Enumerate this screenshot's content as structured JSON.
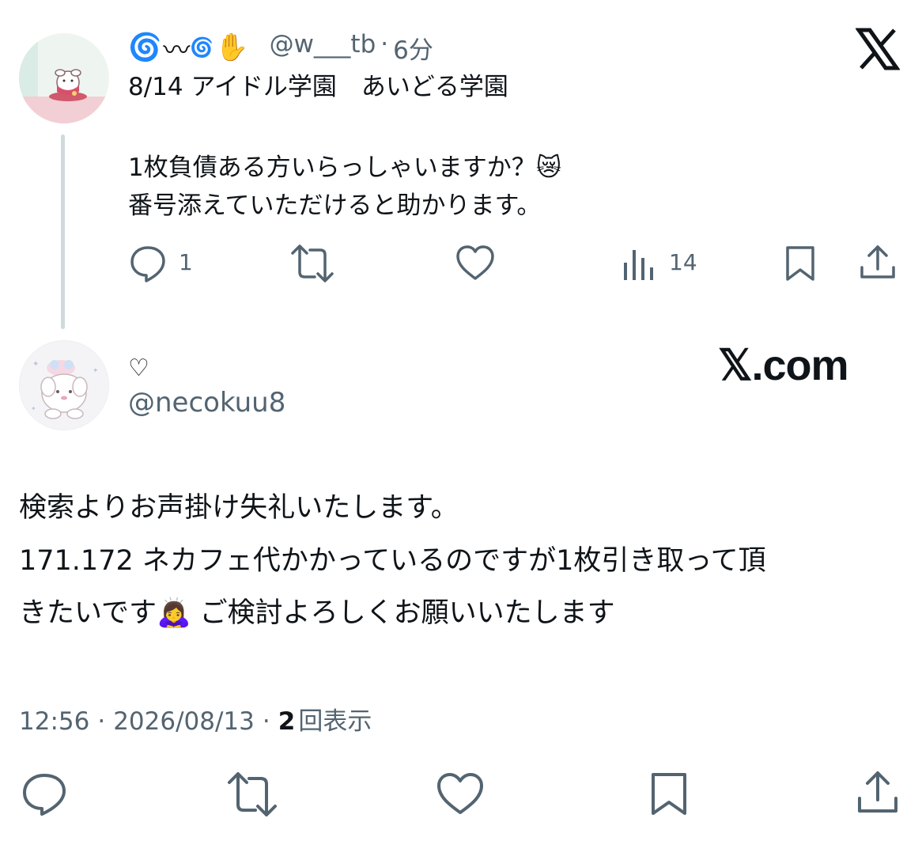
{
  "parent_tweet": {
    "author_name_glyphs": [
      "🌀",
      "〰",
      "🌀",
      "✋"
    ],
    "handle": "@w___tb",
    "separator": "·",
    "time_ago": "6分",
    "lines": [
      "8/14 アイドル学園　あいどる学園",
      "",
      "1枚負債ある方いらっしゃいますか？😿",
      "番号添えていただけると助かります。"
    ],
    "reply_count": "1",
    "retweet_count": "",
    "like_count": "",
    "view_count": "14"
  },
  "main_tweet": {
    "author_name": "♡",
    "handle": "@necokuu8",
    "lines": [
      "検索よりお声掛け失礼いたします。",
      "171.172 ネカフェ代かかっているのですが1枚引き取って頂",
      "きたいです🙇‍♀️ ご検討よろしくお願いいたします"
    ],
    "time": "12:56",
    "date": "2026/08/13",
    "views_count": "2",
    "views_label": "回表示",
    "separator": "·"
  },
  "watermark": "𝕏.com",
  "icons": {
    "x_logo": "x-logo-icon",
    "reply": "reply-icon",
    "retweet": "retweet-icon",
    "like": "heart-icon",
    "views": "views-chart-icon",
    "bookmark": "bookmark-icon",
    "share": "share-icon"
  },
  "colors": {
    "text": "#0f1419",
    "secondary": "#536471",
    "thread_line": "#cfd9de"
  }
}
